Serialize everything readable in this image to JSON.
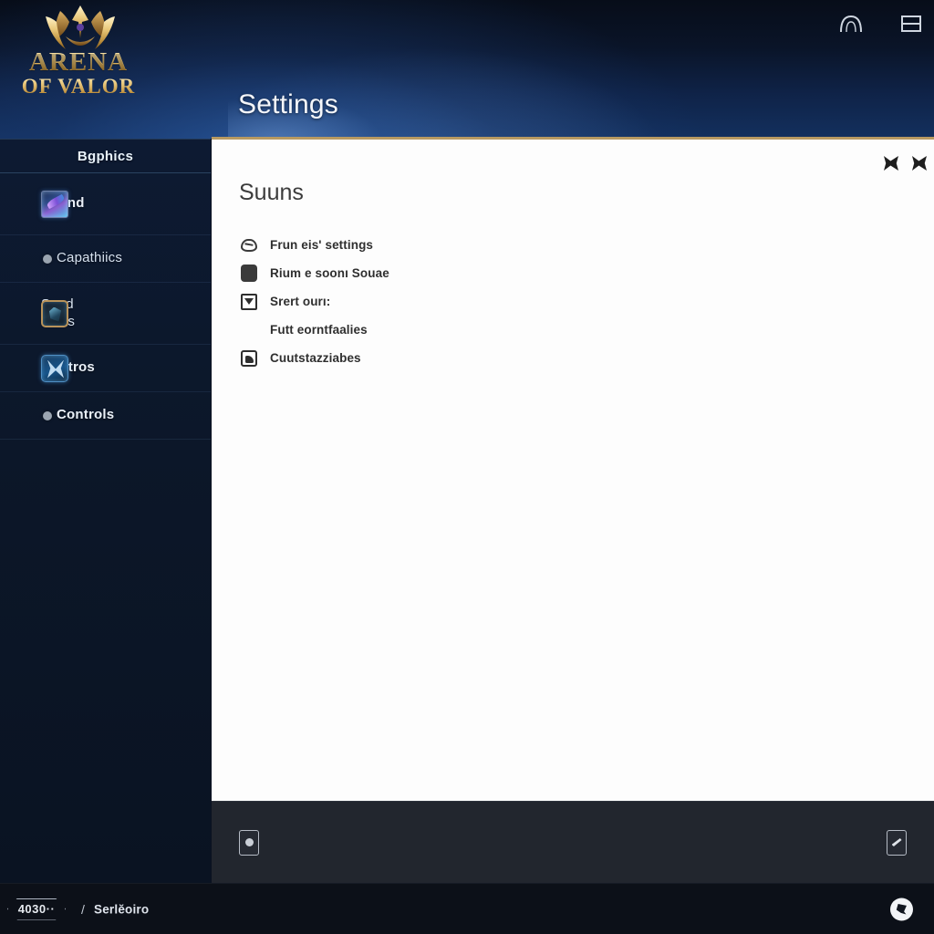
{
  "app": {
    "logo_line1": "ARENA",
    "logo_line2": "OF VALOR",
    "crest_icon": "crown-crest-icon"
  },
  "header": {
    "title": "Settings",
    "window_buttons": [
      {
        "name": "arch-icon",
        "label": ""
      },
      {
        "name": "split-window-icon",
        "label": ""
      }
    ]
  },
  "sidebar": {
    "selected": {
      "label": "Bgphics",
      "name": "sidebar-item-bgphics"
    },
    "items": [
      {
        "label": "Sound",
        "icon": "shard-crystal-icon",
        "style": "icon",
        "weight": "bold"
      },
      {
        "label": "Capathiics",
        "icon": "bullet-dot-icon",
        "style": "bullet",
        "weight": "thin"
      },
      {
        "label": "Sund\natites",
        "icon": "gem-frame-icon",
        "style": "icon",
        "weight": "thin"
      },
      {
        "label": "Contros",
        "icon": "wing-emblem-icon",
        "style": "icon",
        "weight": "bold"
      },
      {
        "label": "Controls",
        "icon": "bullet-dot-icon",
        "style": "bullet",
        "weight": "bold"
      }
    ]
  },
  "panel": {
    "heading": "Suuns",
    "tools": [
      {
        "name": "bowtie-glyph-1-icon"
      },
      {
        "name": "bowtie-glyph-2-icon"
      }
    ],
    "options": [
      {
        "label": "Frun eis' settings",
        "icon": "gem-outline-icon"
      },
      {
        "label": "Rium e soonı Souae",
        "icon": "filled-square-icon"
      },
      {
        "label": "Srert ourı:",
        "icon": "dropdown-square-icon"
      },
      {
        "label": "Futt eorntfaalies",
        "icon": "none"
      },
      {
        "label": "Cuutstazziabes",
        "icon": "image-square-icon"
      }
    ]
  },
  "bottom_bar": {
    "left_button": {
      "name": "dot-panel-button",
      "icon": "dot-icon"
    },
    "right_button": {
      "name": "slash-panel-button",
      "icon": "diagonal-slash-icon"
    }
  },
  "status_bar": {
    "badge": "4030··",
    "separator": "/",
    "label": "Serlĕoirо",
    "right_icon": "sound-swirl-icon"
  },
  "colors": {
    "gold_border": "#b89a62",
    "header_blue": "#13305e",
    "sidebar_navy": "#0c1729",
    "selected_blue": "#20567f",
    "panel_white": "#fdfdfd",
    "bottom_bar": "#22262e",
    "status_bar": "#0c1018"
  }
}
